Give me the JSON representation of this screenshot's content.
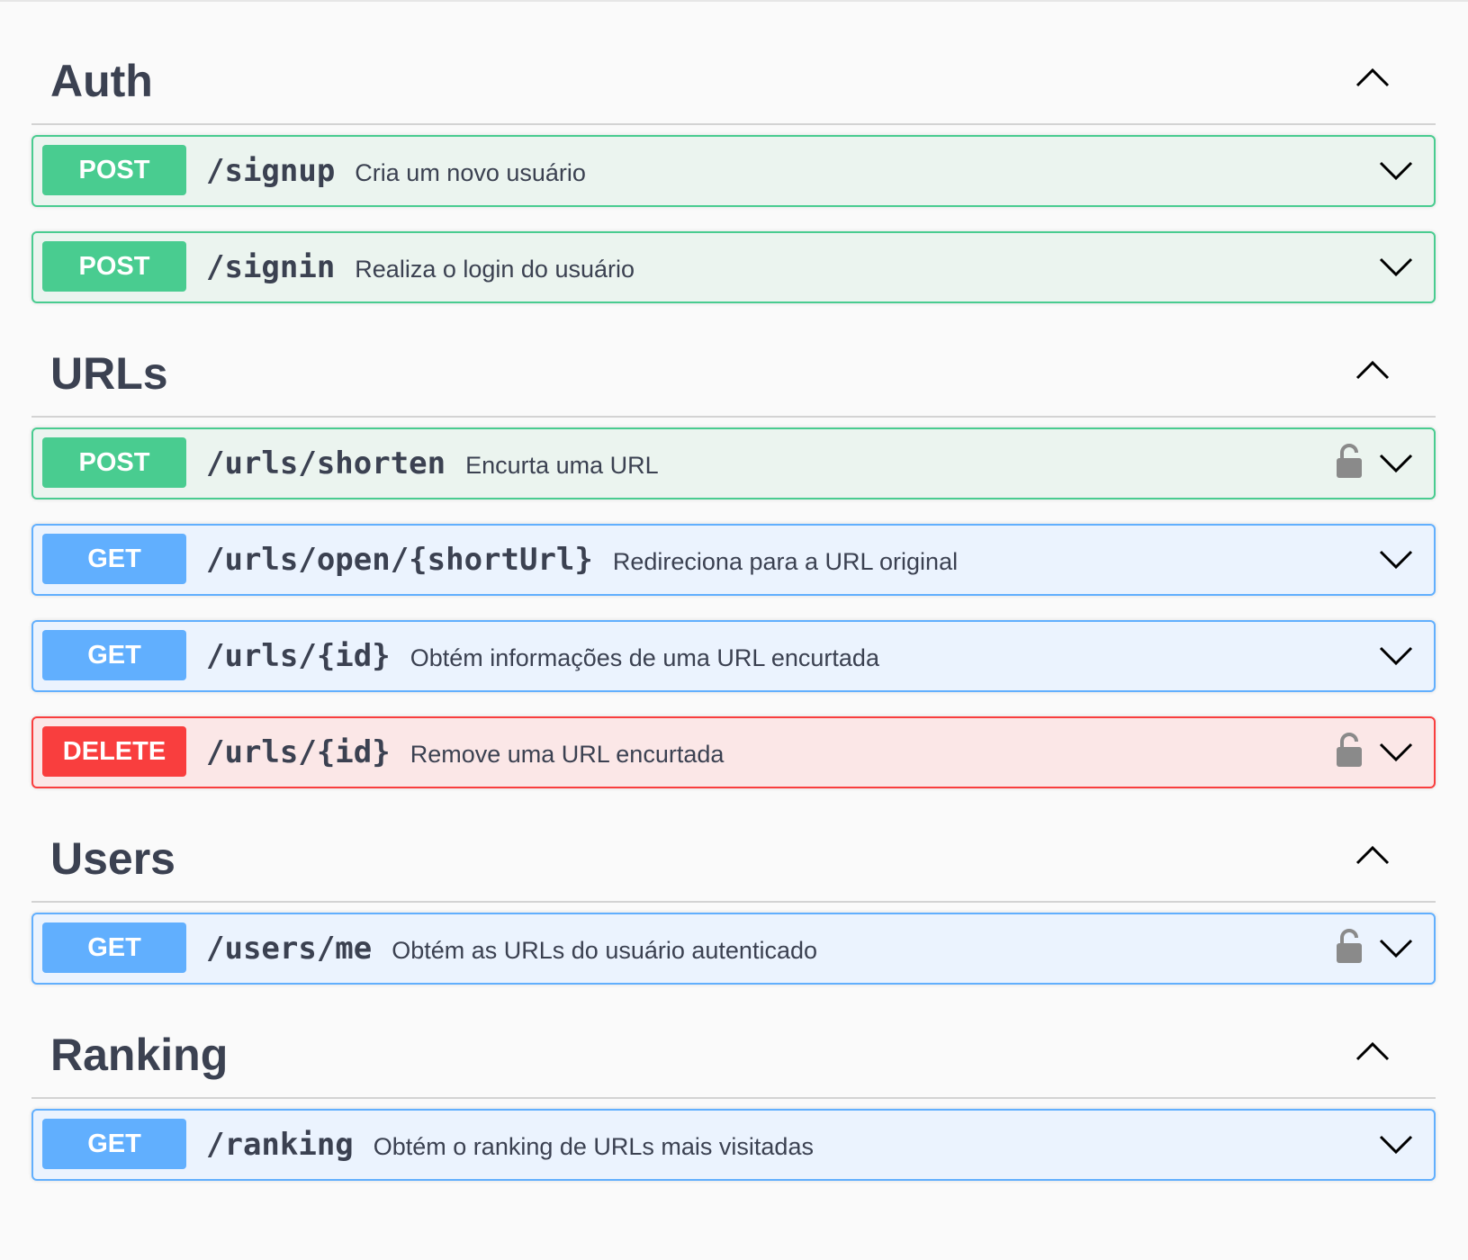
{
  "sections": [
    {
      "title": "Auth",
      "operations": [
        {
          "method": "POST",
          "path": "/signup",
          "summary": "Cria um novo usuário",
          "locked": false
        },
        {
          "method": "POST",
          "path": "/signin",
          "summary": "Realiza o login do usuário",
          "locked": false
        }
      ]
    },
    {
      "title": "URLs",
      "operations": [
        {
          "method": "POST",
          "path": "/urls/shorten",
          "summary": "Encurta uma URL",
          "locked": true
        },
        {
          "method": "GET",
          "path": "/urls/open/{shortUrl}",
          "summary": "Redireciona para a URL original",
          "locked": false
        },
        {
          "method": "GET",
          "path": "/urls/{id}",
          "summary": "Obtém informações de uma URL encurtada",
          "locked": false
        },
        {
          "method": "DELETE",
          "path": "/urls/{id}",
          "summary": "Remove uma URL encurtada",
          "locked": true
        }
      ]
    },
    {
      "title": "Users",
      "operations": [
        {
          "method": "GET",
          "path": "/users/me",
          "summary": "Obtém as URLs do usuário autenticado",
          "locked": true
        }
      ]
    },
    {
      "title": "Ranking",
      "operations": [
        {
          "method": "GET",
          "path": "/ranking",
          "summary": "Obtém o ranking de URLs mais visitadas",
          "locked": false
        }
      ]
    }
  ],
  "icons": {
    "section_toggle": "chevron-up-icon",
    "operation_toggle": "chevron-down-icon",
    "lock": "lock-open-icon"
  },
  "colors": {
    "post": "#49cc90",
    "get": "#61affe",
    "delete": "#f93e3e",
    "title": "#3b4151"
  }
}
